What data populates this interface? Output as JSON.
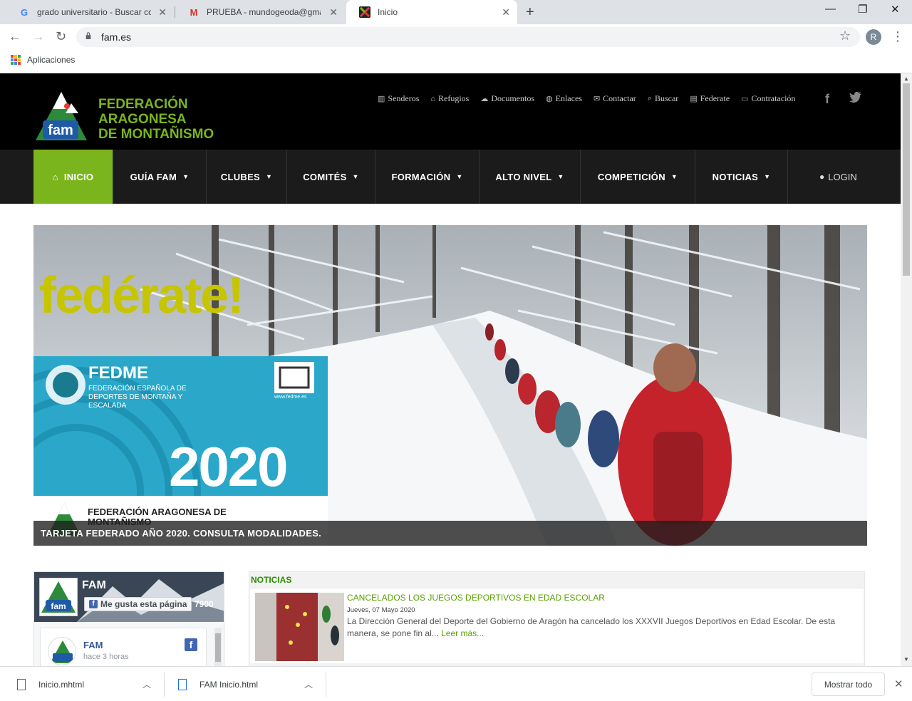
{
  "browser": {
    "tabs": [
      {
        "title": "grado universitario - Buscar con G",
        "icon": "google-icon"
      },
      {
        "title": "PRUEBA - mundogeoda@gmail.c",
        "icon": "gmail-icon"
      },
      {
        "title": "Inicio",
        "icon": "fam-favicon-icon"
      }
    ],
    "url": "fam.es",
    "profile_initial": "R",
    "bookmark_apps_label": "Aplicaciones"
  },
  "site": {
    "logo_lines": [
      "FEDERACIÓN",
      "ARAGONESA",
      "DE MONTAÑISMO"
    ],
    "top_links": [
      {
        "label": "Senderos",
        "icon": "map-icon"
      },
      {
        "label": "Refugios",
        "icon": "home-icon"
      },
      {
        "label": "Documentos",
        "icon": "cloud-icon"
      },
      {
        "label": "Enlaces",
        "icon": "globe-icon"
      },
      {
        "label": "Contactar",
        "icon": "envelope-icon"
      },
      {
        "label": "Buscar",
        "icon": "search-icon"
      },
      {
        "label": "Federate",
        "icon": "document-icon"
      },
      {
        "label": "Contratación",
        "icon": "briefcase-icon"
      }
    ],
    "nav": [
      {
        "label": "INICIO",
        "active": true
      },
      {
        "label": "GUÍA FAM"
      },
      {
        "label": "CLUBES"
      },
      {
        "label": "COMITÉS"
      },
      {
        "label": "FORMACIÓN"
      },
      {
        "label": "ALTO NIVEL"
      },
      {
        "label": "COMPETICIÓN"
      },
      {
        "label": "NOTICIAS"
      }
    ],
    "login_label": "LOGIN",
    "accent_color": "#7ab51d"
  },
  "hero": {
    "headline": "fedérate!",
    "card_title": "FEDME",
    "card_subtitle": "FEDERACIÓN ESPAÑOLA DE DEPORTES DE MONTAÑA Y ESCALADA",
    "card_web": "www.fedme.es",
    "card_year": "2020",
    "card_bottom": "FEDERACIÓN ARAGONESA DE MONTAÑISMO",
    "caption": "TARJETA FEDERADO AÑO 2020. CONSULTA MODALIDADES."
  },
  "facebook": {
    "page_name": "FAM",
    "like_label": "Me gusta esta página",
    "like_count": "7900",
    "post_author": "FAM",
    "post_time": "hace 3 horas"
  },
  "news": {
    "heading": "NOTICIAS",
    "items": [
      {
        "title": "CANCELADOS LOS JUEGOS DEPORTIVOS EN EDAD ESCOLAR",
        "date": "Jueves, 07 Mayo 2020",
        "body": "La Dirección General del Deporte del Gobierno de Aragón ha cancelado los XXXVII Juegos Deportivos en Edad Escolar. De esta manera, se pone fin al...",
        "more": "Leer más..."
      }
    ]
  },
  "downloads": {
    "files": [
      "Inicio.mhtml",
      "FAM Inicio.html"
    ],
    "show_all": "Mostrar todo"
  }
}
